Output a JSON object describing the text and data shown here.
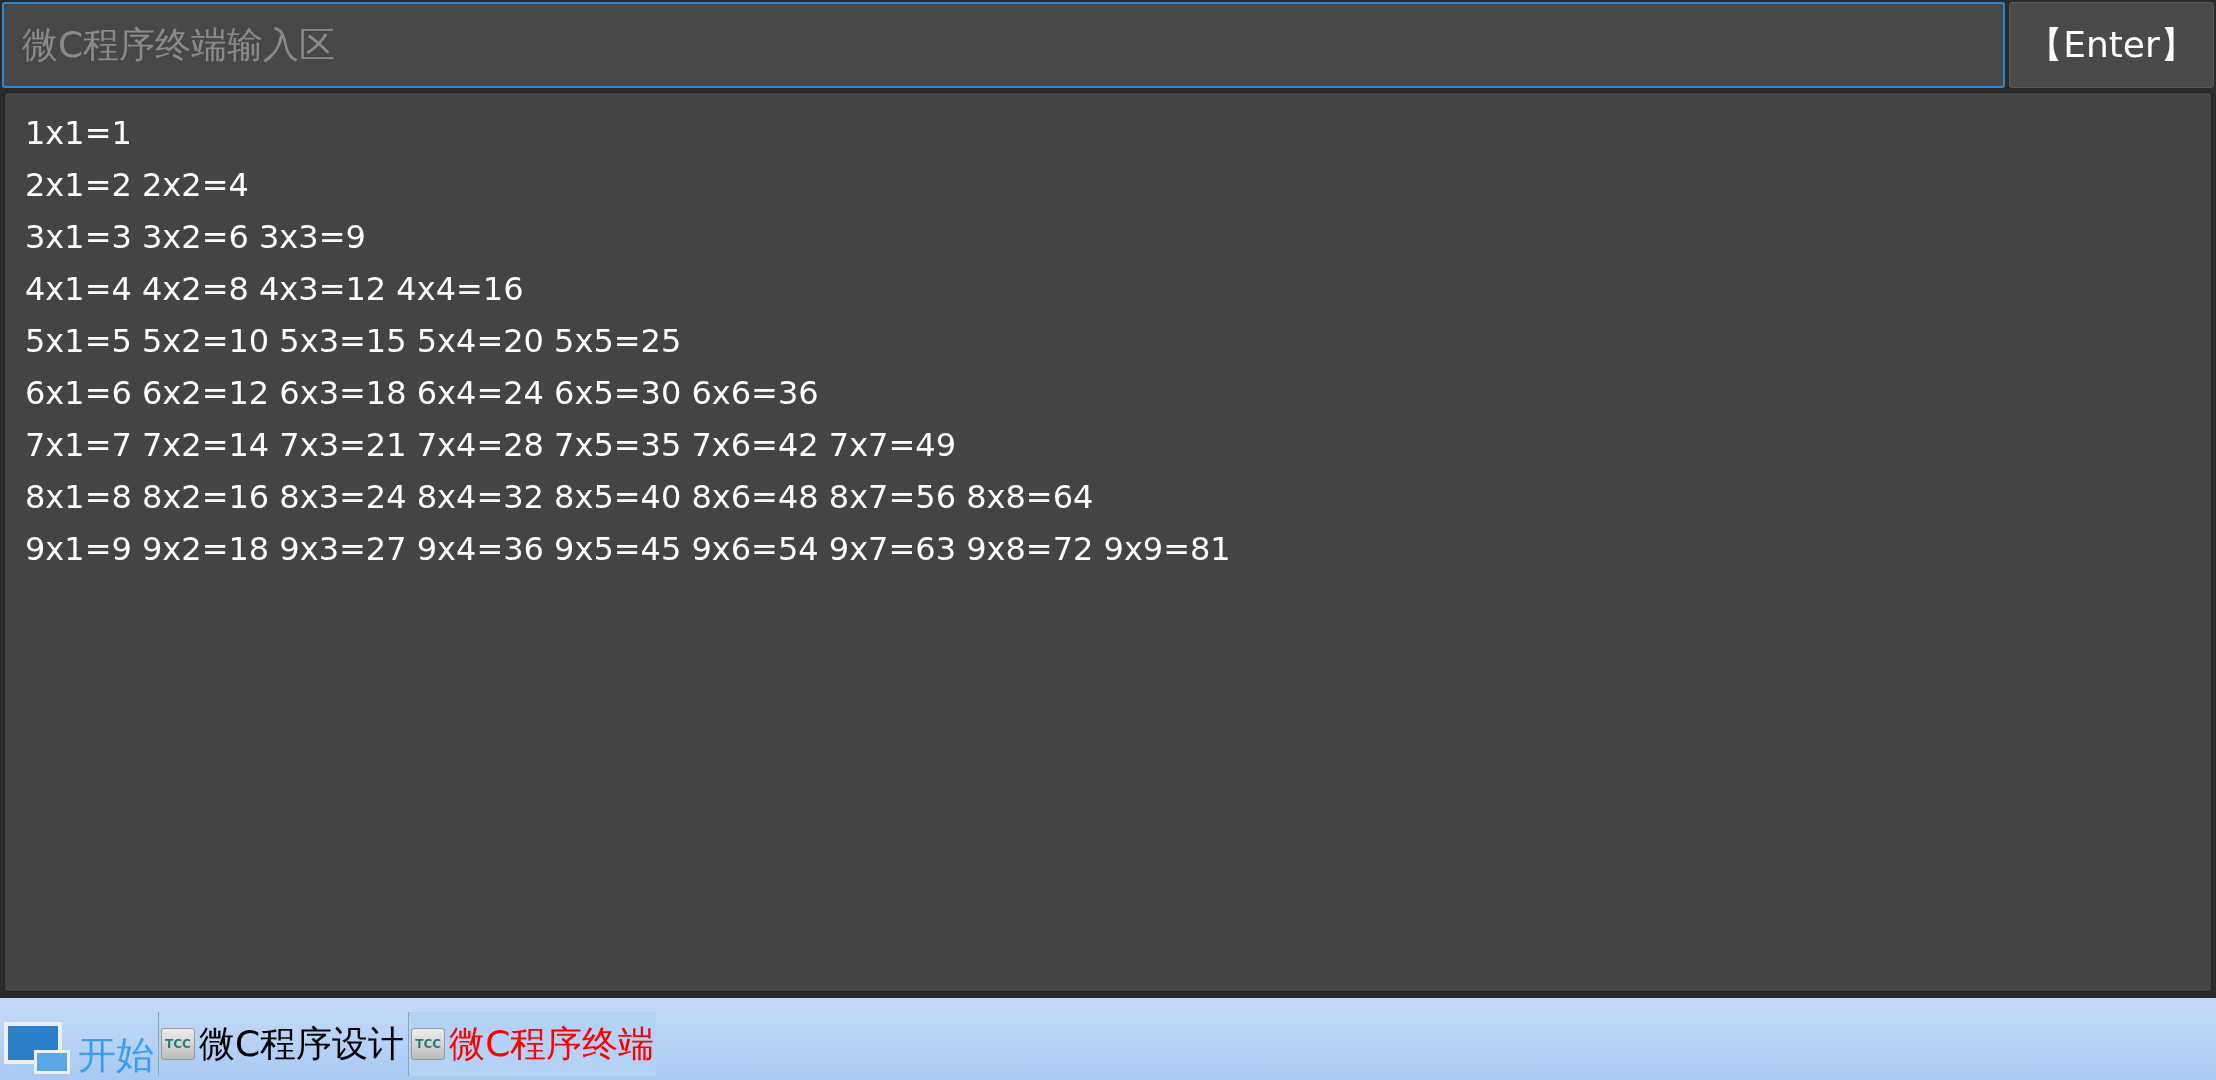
{
  "input": {
    "placeholder": "微C程序终端输入区"
  },
  "enter_button": {
    "label": "【Enter】"
  },
  "output_lines": [
    "1x1=1",
    "2x1=2 2x2=4",
    "3x1=3 3x2=6 3x3=9",
    "4x1=4 4x2=8 4x3=12 4x4=16",
    "5x1=5 5x2=10 5x3=15 5x4=20 5x5=25",
    "6x1=6 6x2=12 6x3=18 6x4=24 6x5=30 6x6=36",
    "7x1=7 7x2=14 7x3=21 7x4=28 7x5=35 7x6=42 7x7=49",
    "8x1=8 8x2=16 8x3=24 8x4=32 8x5=40 8x6=48 8x7=56 8x8=64",
    "9x1=9 9x2=18 9x3=27 9x4=36 9x5=45 9x6=54 9x7=63 9x8=72 9x9=81"
  ],
  "taskbar": {
    "start": {
      "label": "开始"
    },
    "tasks": [
      {
        "icon_label": "TCC",
        "label": "微C程序设计",
        "selected": false
      },
      {
        "icon_label": "TCC",
        "label": "微C程序终端",
        "selected": true
      }
    ]
  }
}
